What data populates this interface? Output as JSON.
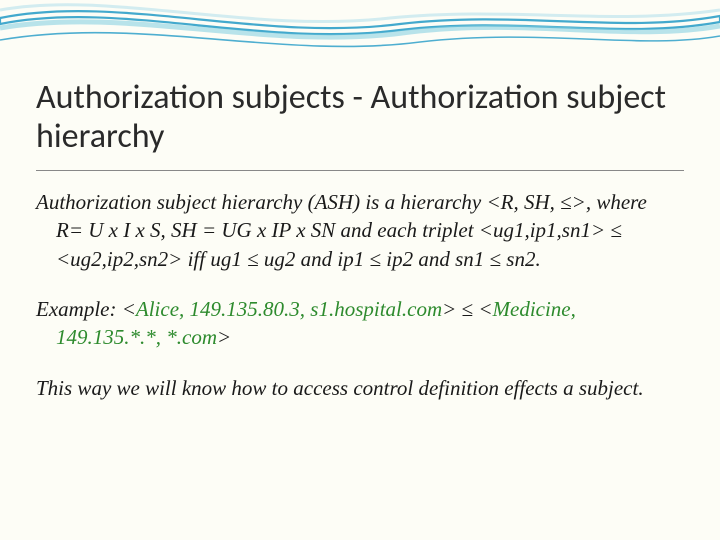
{
  "title": "Authorization subjects - Authorization subject hierarchy",
  "para1": "Authorization subject hierarchy (ASH) is a hierarchy <R, SH, ≤>, where R= U x I x S, SH = UG x IP x SN  and each triplet <ug1,ip1,sn1> ≤ <ug2,ip2,sn2> iff ug1 ≤ ug2 and ip1 ≤ ip2 and sn1 ≤ sn2.",
  "example_prefix": "Example: <",
  "example_tuple1": "Alice, 149.135.80.3, s1.hospital.com",
  "example_mid": "> ≤ <",
  "example_tuple2": "Medicine, 149.135.*.*, *.com",
  "example_suffix": ">",
  "para3": "This way we will know how to access control definition effects a subject."
}
